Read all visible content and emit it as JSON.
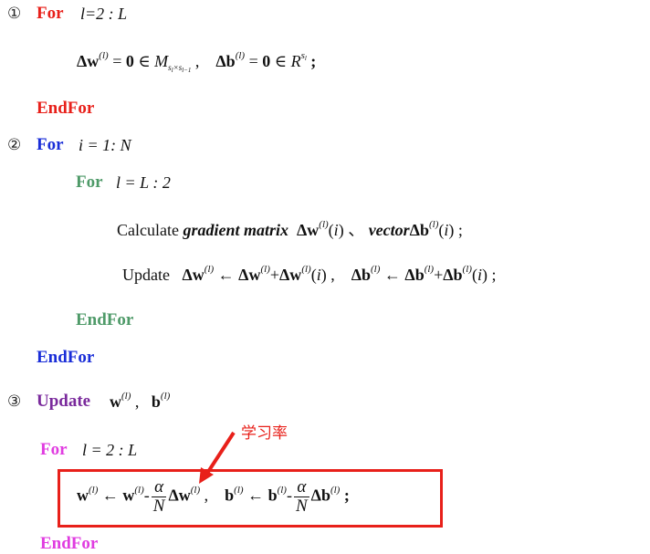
{
  "colors": {
    "red_keyword": "#e8201a",
    "blue_keyword": "#1a2ed8",
    "green_keyword": "#4e9a68",
    "purple_keyword": "#7a2a9c",
    "magenta_keyword": "#e03ce0",
    "highlight_box": "#e8201a"
  },
  "step1": {
    "marker": "①",
    "for_kw": "For",
    "loop": "l=2 : L",
    "end_kw": "EndFor"
  },
  "step2": {
    "marker": "②",
    "for_kw": "For",
    "loop": "i = 1: N",
    "inner_for_kw": "For",
    "inner_loop": "l = L : 2",
    "calc_prefix": "Calculate",
    "calc_bold1": "gradient matrix",
    "calc_sep": "、",
    "calc_bold2": "vector",
    "update_word": "Update",
    "inner_end_kw": "EndFor",
    "end_kw": "EndFor"
  },
  "step3": {
    "marker": "③",
    "update_kw": "Update",
    "for_kw": "For",
    "loop": "l = 2 : L",
    "end_kw": "EndFor"
  },
  "annotation": {
    "label": "学习率"
  }
}
